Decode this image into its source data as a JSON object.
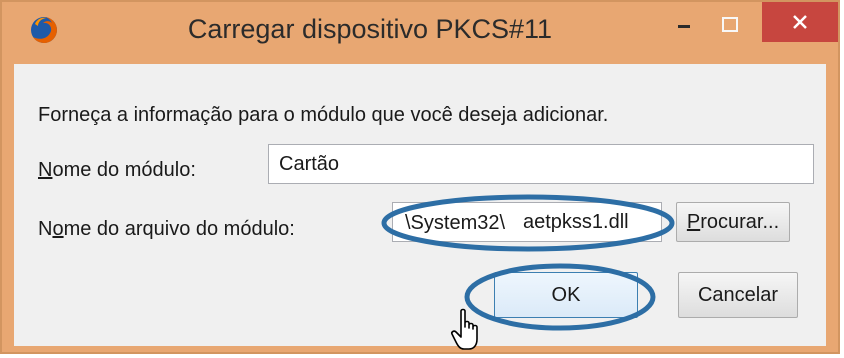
{
  "window": {
    "title": "Carregar dispositivo PKCS#11"
  },
  "dialog": {
    "instruction": "Forneça a informação para o módulo que você deseja adicionar.",
    "module_name": {
      "label_key": "N",
      "label_rest": "ome do módulo:",
      "value": "Cartão"
    },
    "module_file": {
      "label_pre": "N",
      "label_key": "o",
      "label_rest": "me do arquivo do módulo:",
      "value_prefix": "\\System32\\",
      "value_highlight": "aetpkss1.dll"
    },
    "browse_button": {
      "key": "P",
      "rest": "rocurar..."
    },
    "ok_button": "OK",
    "cancel_button": "Cancelar"
  },
  "colors": {
    "frame": "#e8a772",
    "close": "#c7463f",
    "annotation": "#2d6ea5"
  }
}
